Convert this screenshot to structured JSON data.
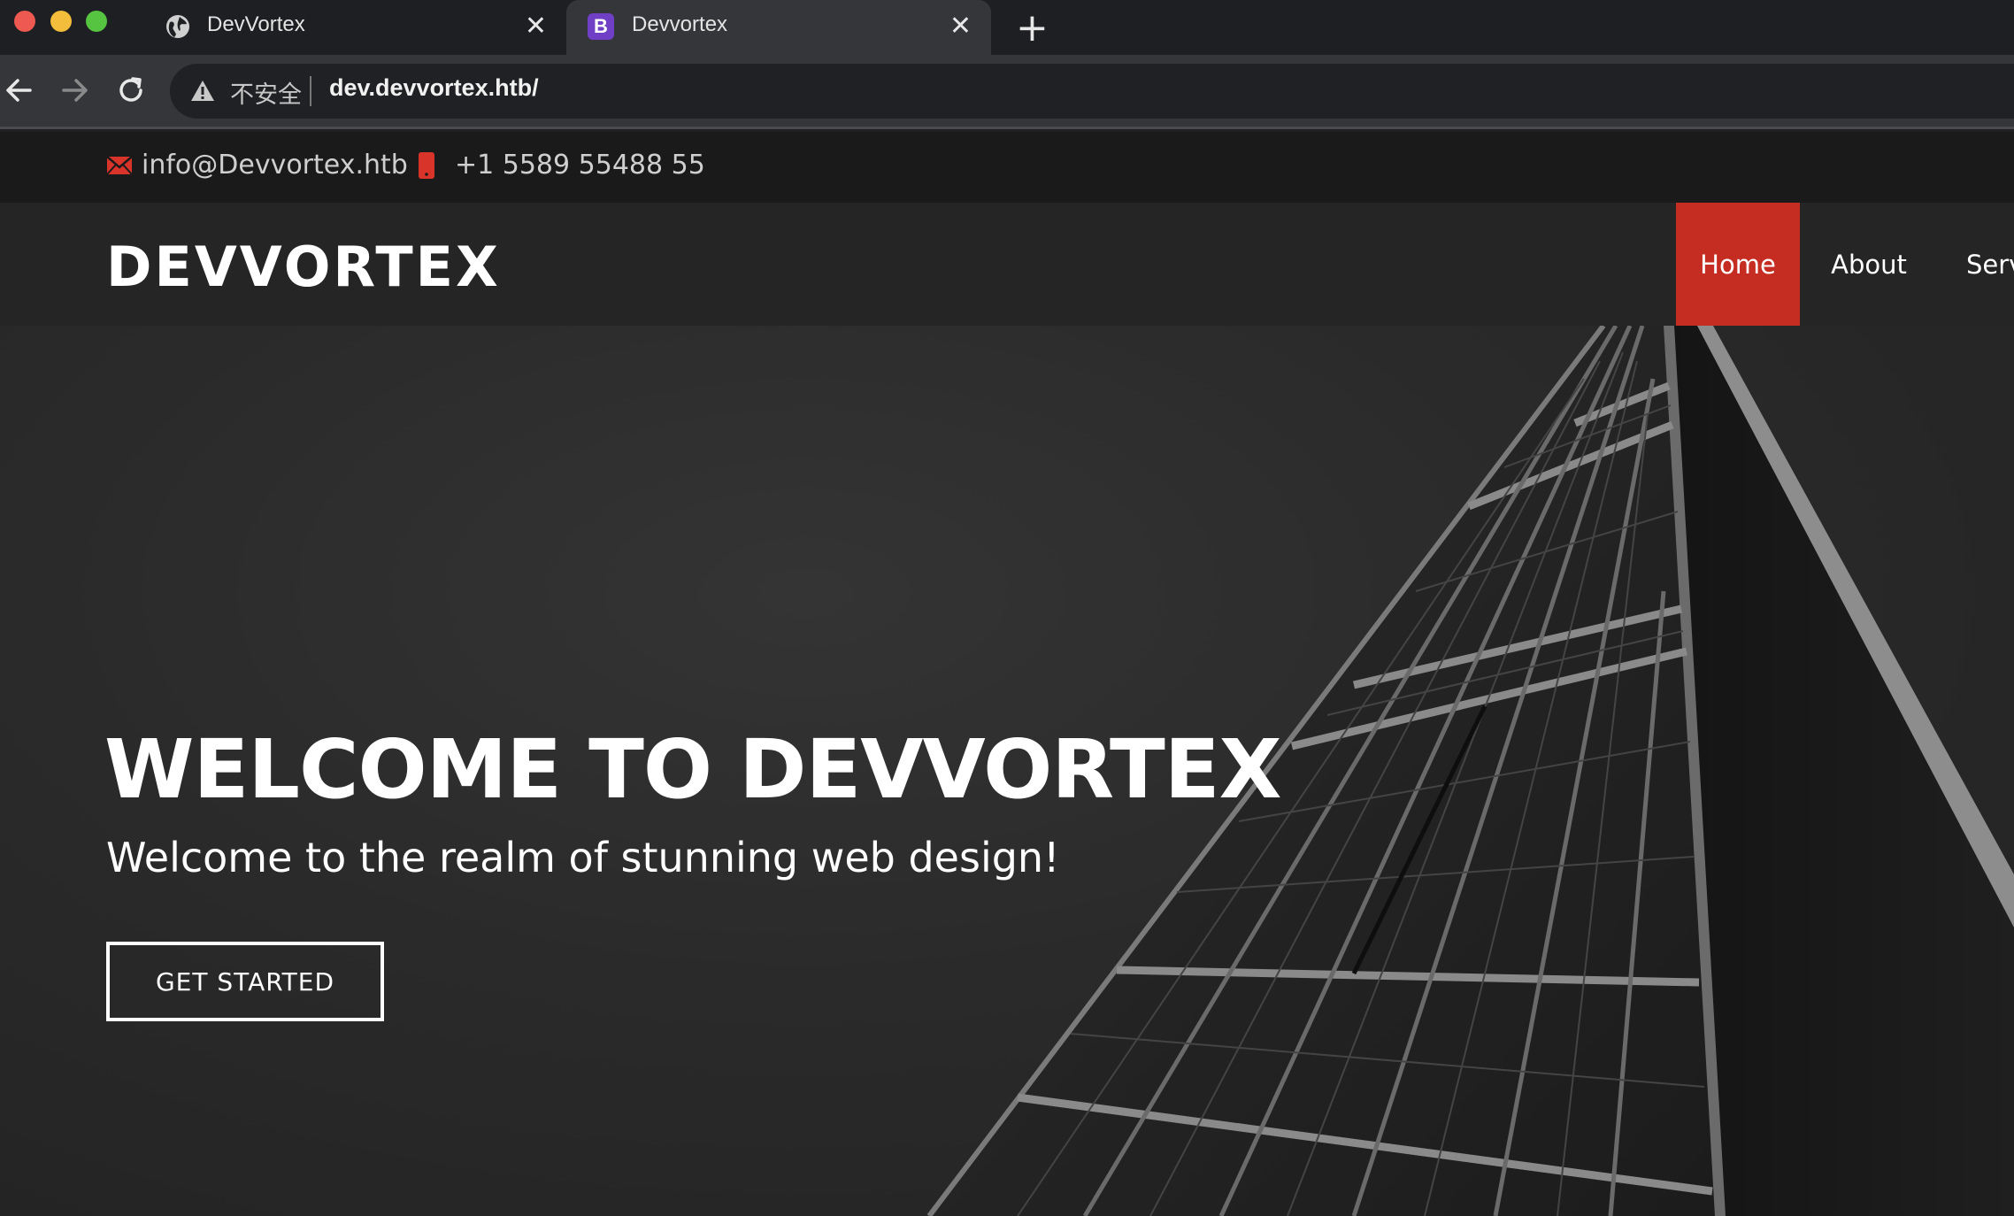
{
  "browser": {
    "tabs": [
      {
        "title": "DevVortex",
        "icon": "globe-icon",
        "close": "✕"
      },
      {
        "title": "Devvortex",
        "icon": "bootstrap-icon",
        "favicon_letter": "B",
        "close": "✕"
      }
    ],
    "new_tab": "+",
    "address": {
      "security": "不安全",
      "url": "dev.devvortex.htb/"
    }
  },
  "topbar": {
    "email": "info@Devvortex.htb",
    "phone": "+1 5589 55488 55"
  },
  "header": {
    "logo": "DEVVORTEX",
    "nav": [
      {
        "label": "Home",
        "active": true
      },
      {
        "label": "About"
      },
      {
        "label": "Serv"
      }
    ]
  },
  "hero": {
    "title": "WELCOME TO DEVVORTEX",
    "subtitle": "Welcome to the realm of stunning web design!",
    "cta": "GET STARTED"
  },
  "colors": {
    "accent": "#c62d22",
    "header_bg": "#252525",
    "topbar_bg": "#1a1a1a"
  }
}
